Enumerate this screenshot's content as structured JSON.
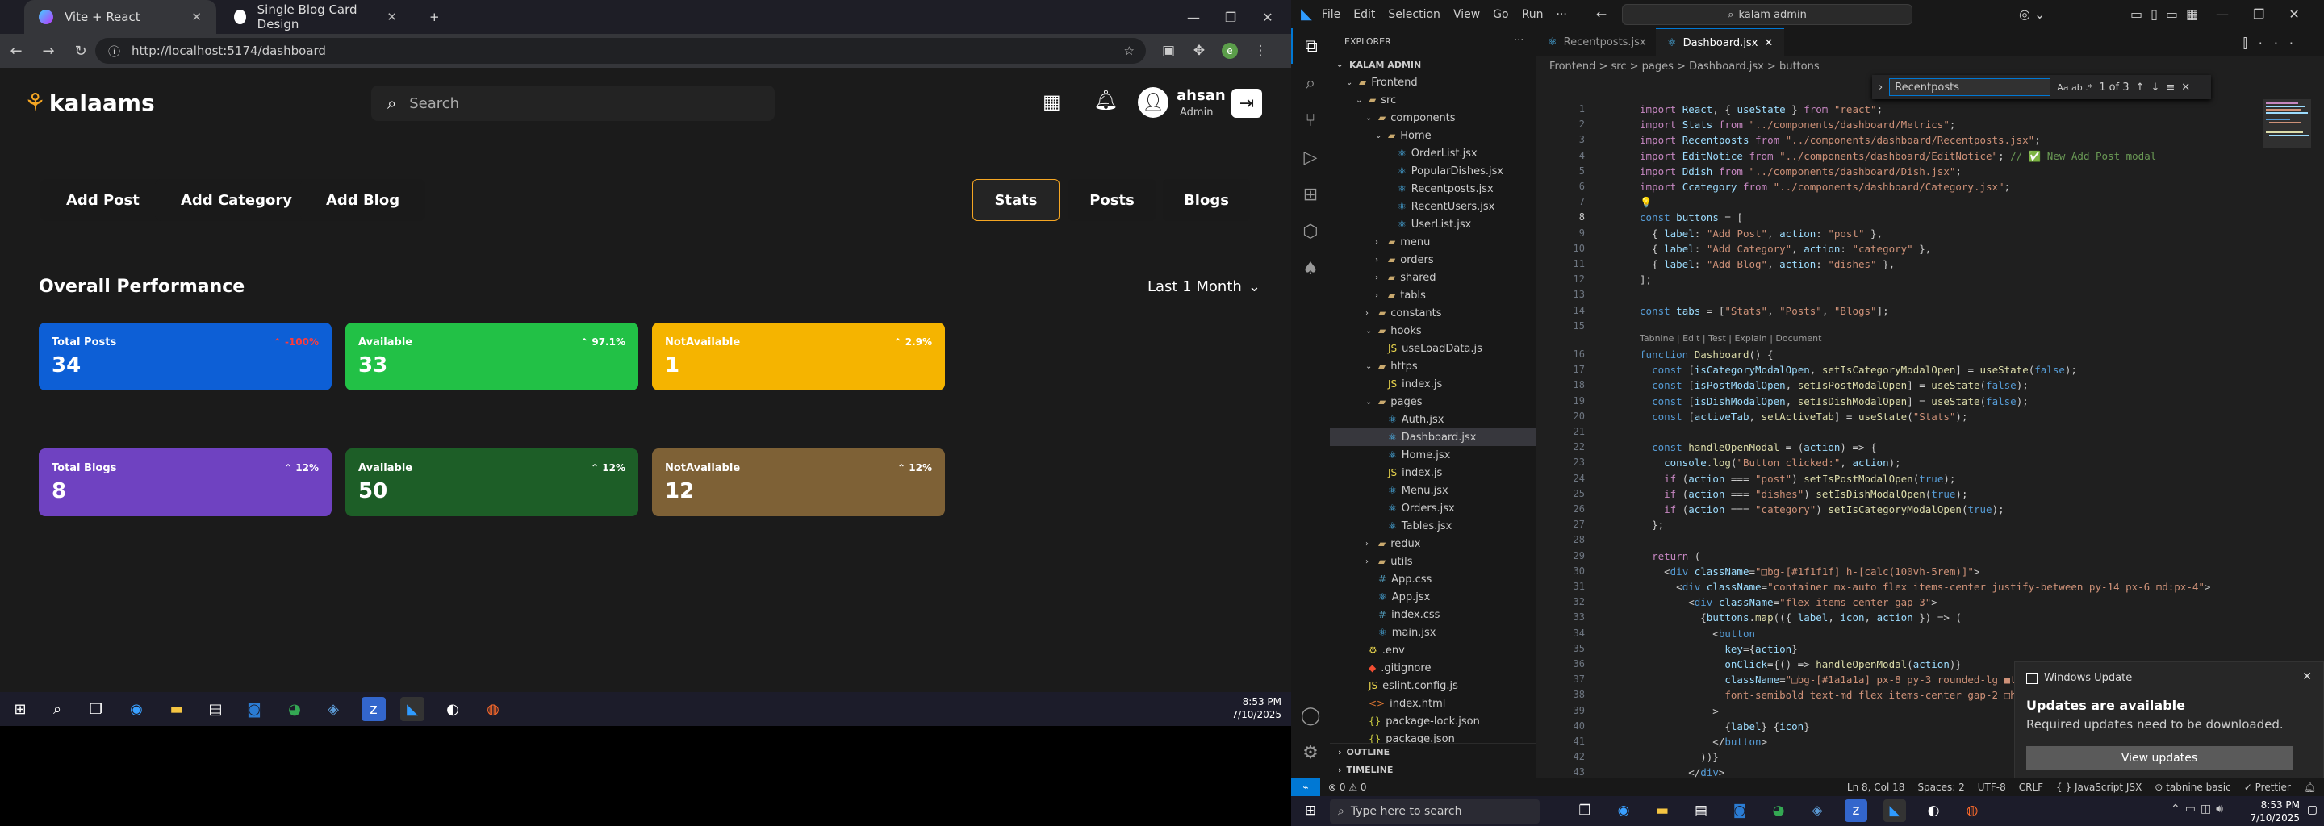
{
  "browser": {
    "tabs": [
      {
        "title": "Vite + React"
      },
      {
        "title": "Single Blog Card Design"
      }
    ],
    "url": "http://localhost:5174/dashboard"
  },
  "app": {
    "logo": "kalaams",
    "search_placeholder": "Search",
    "user": {
      "name": "ahsan",
      "role": "Admin"
    },
    "action_buttons": [
      "Add Post",
      "Add Category",
      "Add Blog"
    ],
    "tabs": [
      "Stats",
      "Posts",
      "Blogs"
    ],
    "active_tab": "Stats",
    "section_title": "Overall Performance",
    "period": "Last 1 Month",
    "cards_row1": [
      {
        "label": "Total Posts",
        "value": "34",
        "pct": "-100%",
        "color": "#0d5fd6",
        "pct_color": "#ff3b3b"
      },
      {
        "label": "Available",
        "value": "33",
        "pct": "97.1%",
        "color": "#22c146",
        "pct_color": "#ffffff"
      },
      {
        "label": "NotAvailable",
        "value": "1",
        "pct": "2.9%",
        "color": "#f5b400",
        "pct_color": "#ffffff"
      }
    ],
    "cards_row2": [
      {
        "label": "Total Blogs",
        "value": "8",
        "pct": "12%",
        "color": "#6f42c1",
        "pct_color": "#ffffff"
      },
      {
        "label": "Available",
        "value": "50",
        "pct": "12%",
        "color": "#1d5e27",
        "pct_color": "#ffffff"
      },
      {
        "label": "NotAvailable",
        "value": "12",
        "pct": "12%",
        "color": "#7e6136",
        "pct_color": "#ffffff"
      }
    ]
  },
  "taskbar_left": {
    "time": "8:53 PM",
    "date": "7/10/2025"
  },
  "vscode": {
    "menu": [
      "File",
      "Edit",
      "Selection",
      "View",
      "Go",
      "Run",
      "···"
    ],
    "command_center": "kalam admin",
    "explorer_title": "EXPLORER",
    "root": "KALAM ADMIN",
    "tree": [
      {
        "label": "Frontend",
        "depth": 1,
        "type": "folder",
        "open": true
      },
      {
        "label": "src",
        "depth": 2,
        "type": "folder",
        "open": true
      },
      {
        "label": "components",
        "depth": 3,
        "type": "folder",
        "open": true
      },
      {
        "label": "Home",
        "depth": 4,
        "type": "folder",
        "open": true
      },
      {
        "label": "OrderList.jsx",
        "depth": 5,
        "type": "jsx"
      },
      {
        "label": "PopularDishes.jsx",
        "depth": 5,
        "type": "jsx"
      },
      {
        "label": "Recentposts.jsx",
        "depth": 5,
        "type": "jsx"
      },
      {
        "label": "RecentUsers.jsx",
        "depth": 5,
        "type": "jsx"
      },
      {
        "label": "UserList.jsx",
        "depth": 5,
        "type": "jsx"
      },
      {
        "label": "menu",
        "depth": 4,
        "type": "folder",
        "open": false
      },
      {
        "label": "orders",
        "depth": 4,
        "type": "folder",
        "open": false
      },
      {
        "label": "shared",
        "depth": 4,
        "type": "folder",
        "open": false
      },
      {
        "label": "tabls",
        "depth": 4,
        "type": "folder",
        "open": false
      },
      {
        "label": "constants",
        "depth": 3,
        "type": "folder",
        "open": false
      },
      {
        "label": "hooks",
        "depth": 3,
        "type": "folder",
        "open": true
      },
      {
        "label": "useLoadData.js",
        "depth": 4,
        "type": "js"
      },
      {
        "label": "https",
        "depth": 3,
        "type": "folder",
        "open": true
      },
      {
        "label": "index.js",
        "depth": 4,
        "type": "js"
      },
      {
        "label": "pages",
        "depth": 3,
        "type": "folder",
        "open": true
      },
      {
        "label": "Auth.jsx",
        "depth": 4,
        "type": "jsx"
      },
      {
        "label": "Dashboard.jsx",
        "depth": 4,
        "type": "jsx",
        "selected": true
      },
      {
        "label": "Home.jsx",
        "depth": 4,
        "type": "jsx"
      },
      {
        "label": "index.js",
        "depth": 4,
        "type": "js"
      },
      {
        "label": "Menu.jsx",
        "depth": 4,
        "type": "jsx"
      },
      {
        "label": "Orders.jsx",
        "depth": 4,
        "type": "jsx"
      },
      {
        "label": "Tables.jsx",
        "depth": 4,
        "type": "jsx"
      },
      {
        "label": "redux",
        "depth": 3,
        "type": "folder",
        "open": false
      },
      {
        "label": "utils",
        "depth": 3,
        "type": "folder",
        "open": false
      },
      {
        "label": "App.css",
        "depth": 3,
        "type": "css"
      },
      {
        "label": "App.jsx",
        "depth": 3,
        "type": "jsx"
      },
      {
        "label": "index.css",
        "depth": 3,
        "type": "css"
      },
      {
        "label": "main.jsx",
        "depth": 3,
        "type": "jsx"
      },
      {
        "label": ".env",
        "depth": 2,
        "type": "env"
      },
      {
        "label": ".gitignore",
        "depth": 2,
        "type": "git"
      },
      {
        "label": "eslint.config.js",
        "depth": 2,
        "type": "js"
      },
      {
        "label": "index.html",
        "depth": 2,
        "type": "html"
      },
      {
        "label": "package-lock.json",
        "depth": 2,
        "type": "json"
      },
      {
        "label": "package.json",
        "depth": 2,
        "type": "json"
      }
    ],
    "outline": "OUTLINE",
    "timeline": "TIMELINE",
    "editor_tabs": [
      {
        "label": "Recentposts.jsx"
      },
      {
        "label": "Dashboard.jsx"
      }
    ],
    "breadcrumb": "Frontend > src > pages > Dashboard.jsx > buttons",
    "find": {
      "query": "Recentposts",
      "count": "1 of 3"
    },
    "codelens": "Tabnine | Edit | Test | Explain | Document",
    "status": {
      "errors": "⊗ 0 ⚠ 0",
      "position": "Ln 8, Col 18",
      "spaces": "Spaces: 2",
      "encoding": "UTF-8",
      "eol": "CRLF",
      "lang": "{ } JavaScript JSX",
      "tabnine": "⊙ tabnine basic",
      "prettier": "✓ Prettier"
    },
    "notification": {
      "source": "Windows Update",
      "title": "Updates are available",
      "body": "Required updates need to be downloaded.",
      "button": "View updates"
    }
  },
  "taskbar_right": {
    "search_placeholder": "Type here to search",
    "time": "8:53 PM",
    "date": "7/10/2025"
  }
}
